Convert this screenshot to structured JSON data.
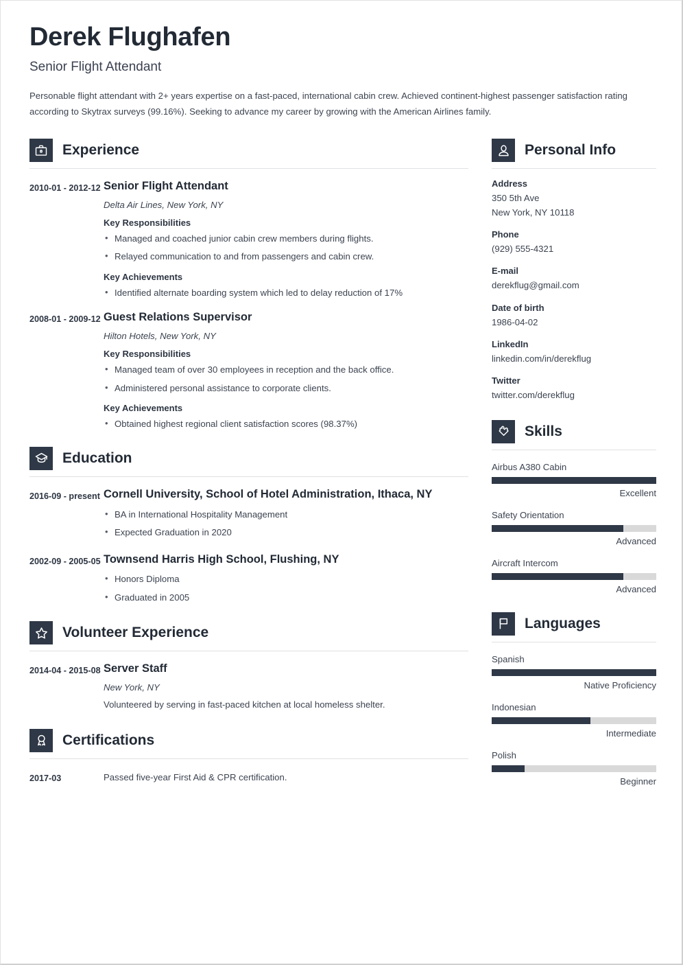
{
  "header": {
    "name": "Derek Flughafen",
    "job_title": "Senior Flight Attendant",
    "summary": "Personable flight attendant with 2+ years expertise on a fast-paced, international cabin crew. Achieved continent-highest passenger satisfaction rating according to Skytrax surveys (99.16%). Seeking to advance my career by growing with the American Airlines family."
  },
  "experience": {
    "title": "Experience",
    "icon": "briefcase-icon",
    "entries": [
      {
        "date": "2010-01 - 2012-12",
        "role": "Senior Flight Attendant",
        "org": "Delta Air Lines, New York, NY",
        "responsibilities_label": "Key Responsibilities",
        "responsibilities": [
          "Managed and coached junior cabin crew members during flights.",
          "Relayed communication to and from passengers and cabin crew."
        ],
        "achievements_label": "Key Achievements",
        "achievements": [
          "Identified alternate boarding system which led to delay reduction of 17%"
        ]
      },
      {
        "date": "2008-01 - 2009-12",
        "role": "Guest Relations Supervisor",
        "org": "Hilton Hotels, New York, NY",
        "responsibilities_label": "Key Responsibilities",
        "responsibilities": [
          "Managed team of over 30 employees in reception and the back office.",
          "Administered personal assistance to corporate clients."
        ],
        "achievements_label": "Key Achievements",
        "achievements": [
          "Obtained highest regional client satisfaction scores (98.37%)"
        ]
      }
    ]
  },
  "education": {
    "title": "Education",
    "icon": "graduation-cap-icon",
    "entries": [
      {
        "date": "2016-09 - present",
        "school": "Cornell University, School of Hotel Administration, Ithaca, NY",
        "bullets": [
          "BA in International Hospitality Management",
          "Expected Graduation in 2020"
        ]
      },
      {
        "date": "2002-09 - 2005-05",
        "school": "Townsend Harris High School, Flushing, NY",
        "bullets": [
          "Honors Diploma",
          "Graduated in 2005"
        ]
      }
    ]
  },
  "volunteer": {
    "title": "Volunteer Experience",
    "icon": "star-icon",
    "entries": [
      {
        "date": "2014-04 - 2015-08",
        "role": "Server Staff",
        "org": "New York, NY",
        "note": "Volunteered by serving in fast-paced kitchen at local homeless shelter."
      }
    ]
  },
  "certifications": {
    "title": "Certifications",
    "icon": "award-ribbon-icon",
    "entries": [
      {
        "date": "2017-03",
        "text": "Passed five-year First Aid & CPR certification."
      }
    ]
  },
  "personal_info": {
    "title": "Personal Info",
    "icon": "person-icon",
    "groups": [
      {
        "label": "Address",
        "value": "350 5th Ave\nNew York, NY 10118",
        "line1": "350 5th Ave",
        "line2": "New York, NY 10118"
      },
      {
        "label": "Phone",
        "value": "(929) 555-4321"
      },
      {
        "label": "E-mail",
        "value": "derekflug@gmail.com"
      },
      {
        "label": "Date of birth",
        "value": "1986-04-02"
      },
      {
        "label": "LinkedIn",
        "value": "linkedin.com/in/derekflug"
      },
      {
        "label": "Twitter",
        "value": "twitter.com/derekflug"
      }
    ]
  },
  "skills": {
    "title": "Skills",
    "icon": "puzzle-piece-icon",
    "items": [
      {
        "name": "Airbus A380 Cabin",
        "level": "Excellent",
        "percent": 100
      },
      {
        "name": "Safety Orientation",
        "level": "Advanced",
        "percent": 80
      },
      {
        "name": "Aircraft Intercom",
        "level": "Advanced",
        "percent": 80
      }
    ]
  },
  "languages": {
    "title": "Languages",
    "icon": "flag-icon",
    "items": [
      {
        "name": "Spanish",
        "level": "Native Proficiency",
        "percent": 100
      },
      {
        "name": "Indonesian",
        "level": "Intermediate",
        "percent": 60
      },
      {
        "name": "Polish",
        "level": "Beginner",
        "percent": 20
      }
    ]
  },
  "colors": {
    "accent_dark": "#2f3846",
    "text_heading": "#222a35",
    "text_body": "#3c4350",
    "bar_track": "#d9d9d9",
    "rule": "#e0e1e3"
  }
}
